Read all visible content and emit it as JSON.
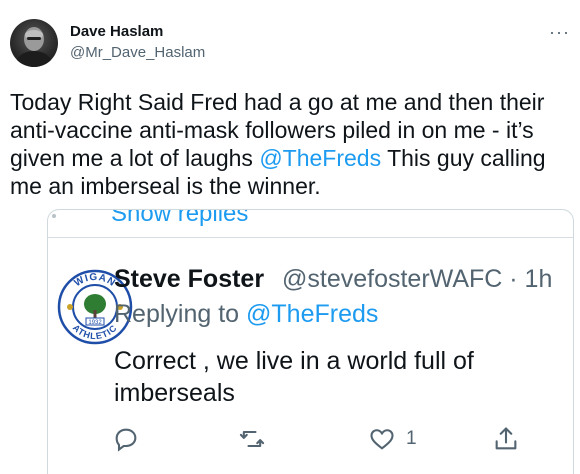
{
  "tweet": {
    "author_name": "Dave Haslam",
    "author_handle": "@Mr_Dave_Haslam",
    "more_label": "···",
    "text_part1": "Today Right Said Fred had a go at me and then their anti-vaccine anti-mask followers piled in on me - it’s given me a lot of laughs ",
    "mention": "@TheFreds",
    "text_part2": " This guy calling me an imberseal is the winner."
  },
  "embedded_reply": {
    "show_replies_label": "Show replies",
    "author_name": "Steve Foster",
    "author_handle_time": "@stevefosterWAFC · 1h",
    "replying_prefix": "Replying to ",
    "replying_to": "@TheFreds",
    "text": "Correct , we live in a world full of imberseals",
    "badge_text_top": "WIGAN",
    "badge_text_bottom": "ATHLETIC",
    "badge_year": "1932",
    "like_count": "1",
    "icons": [
      "reply-icon",
      "retweet-icon",
      "like-icon",
      "share-icon"
    ],
    "colors": {
      "badge_blue": "#1f4ea8",
      "link_blue": "#1d9bf0",
      "muted": "#536471"
    }
  }
}
